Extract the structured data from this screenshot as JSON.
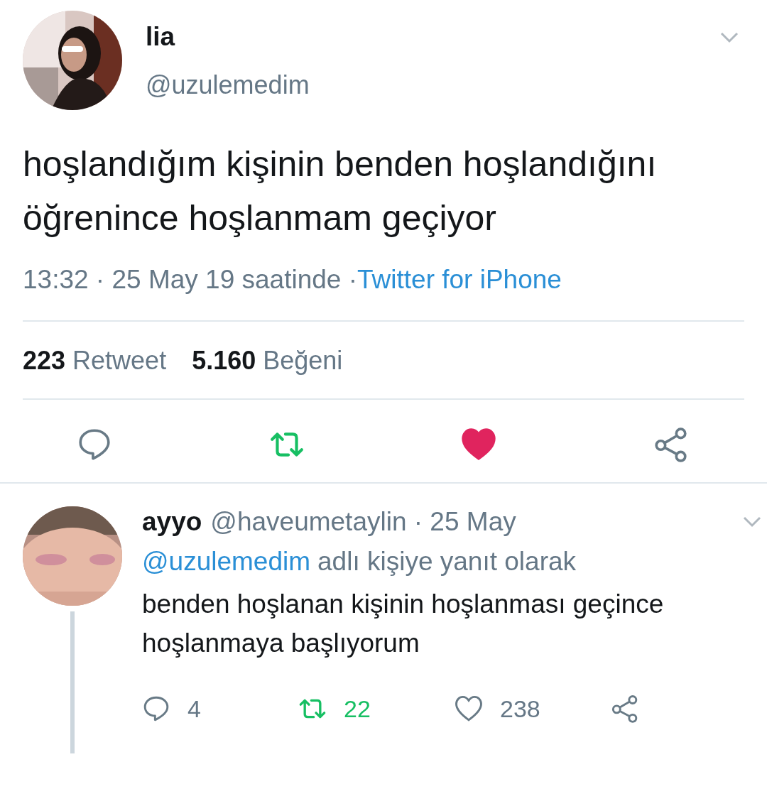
{
  "tweet": {
    "name": "lia",
    "handle": "@uzulemedim",
    "text": "hoşlandığım kişinin benden hoşlandığını öğrenince hoşlanmam geçiyor",
    "time": "13:32 · 25 May 19 saatinde ·",
    "source": "Twitter for iPhone",
    "retweets": "223",
    "retweets_label": "Retweet",
    "likes": "5.160",
    "likes_label": "Beğeni",
    "liked": true
  },
  "reply": {
    "name": "ayyo",
    "handle": "@haveumetaylin · 25 May",
    "reply_to": "@uzulemedim",
    "reply_to_suffix": "adlı kişiye yanıt olarak",
    "text": "benden hoşlanan kişinin hoşlanması geçince hoşlanmaya başlıyorum",
    "replies": "4",
    "retweets": "22",
    "likes": "238",
    "liked": false
  }
}
